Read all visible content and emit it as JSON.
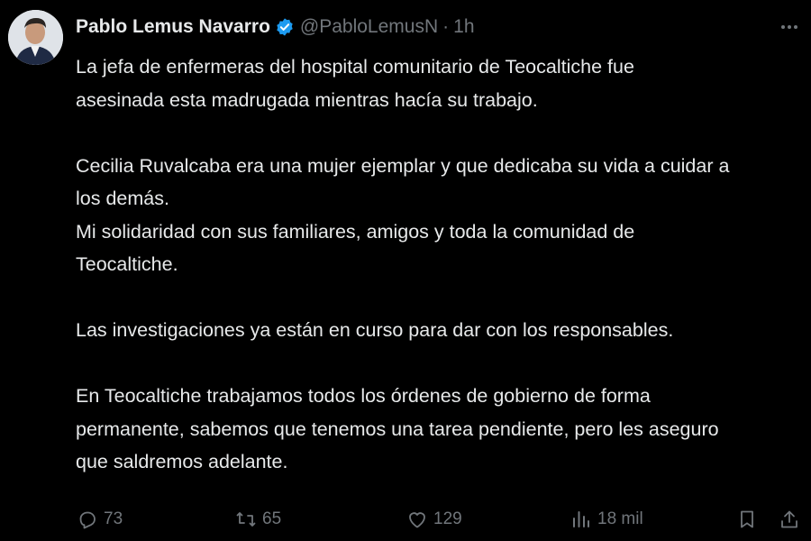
{
  "author": {
    "name": "Pablo Lemus Navarro",
    "handle": "@PabloLemusN",
    "separator": "·",
    "time": "1h",
    "verified_color": "#1d9bf0"
  },
  "tweet": {
    "paragraphs": [
      [
        "La jefa de enfermeras del hospital comunitario de Teocaltiche fue",
        "asesinada esta madrugada mientras hacía su trabajo."
      ],
      [
        "Cecilia Ruvalcaba era una mujer ejemplar y que dedicaba su vida a cuidar a",
        "los demás.",
        "Mi solidaridad con sus familiares, amigos y toda la comunidad de",
        "Teocaltiche."
      ],
      [
        "Las investigaciones ya están en curso para dar con los responsables."
      ],
      [
        "En Teocaltiche trabajamos todos los órdenes de gobierno de forma",
        "permanente, sabemos que tenemos una tarea pendiente, pero les aseguro",
        "que saldremos adelante."
      ]
    ]
  },
  "actions": {
    "replies": "73",
    "reposts": "65",
    "likes": "129",
    "views": "18 mil"
  },
  "colors": {
    "background": "#000000",
    "text": "#e7e9ea",
    "muted": "#71767b"
  }
}
